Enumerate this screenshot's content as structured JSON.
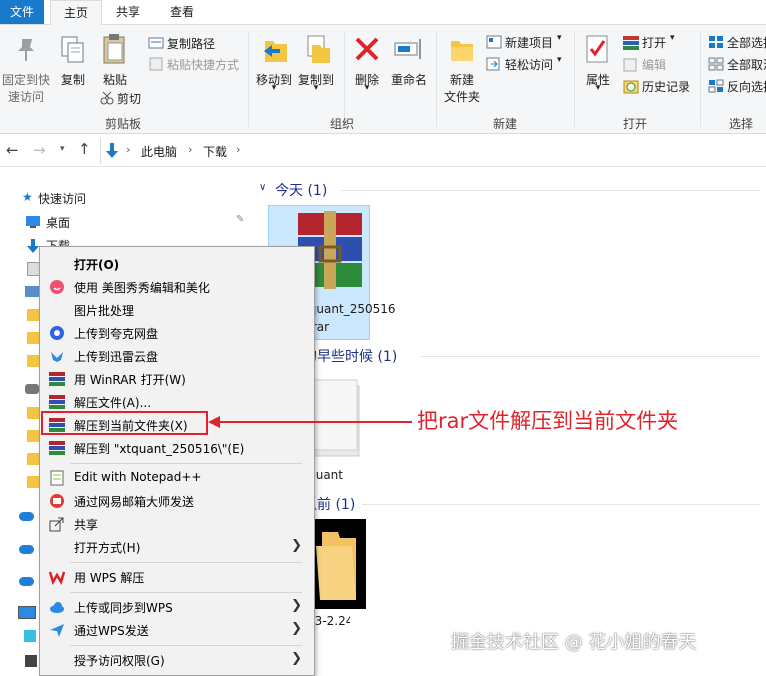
{
  "ribbon_tabs": [
    "文件",
    "主页",
    "共享",
    "查看"
  ],
  "ribbon": {
    "clipboard": {
      "pin": "固定到快",
      "pin2": "速访问",
      "copy": "复制",
      "paste": "粘贴",
      "copy_path": "复制路径",
      "paste_shortcut": "粘贴快捷方式",
      "cut": "剪切",
      "label": "剪贴板"
    },
    "organize": {
      "move_to": "移动到",
      "copy_to": "复制到",
      "delete": "删除",
      "rename": "重命名",
      "label": "组织"
    },
    "new": {
      "new_folder": "新建",
      "new_folder2": "文件夹",
      "new_item": "新建项目",
      "easy_access": "轻松访问",
      "label": "新建"
    },
    "open": {
      "properties": "属性",
      "open": "打开",
      "edit": "编辑",
      "history": "历史记录",
      "label": "打开"
    },
    "select": {
      "select_all": "全部选择",
      "select_none": "全部取消",
      "invert": "反向选择",
      "label": "选择"
    }
  },
  "breadcrumb": [
    "此电脑",
    "下载"
  ],
  "nav": {
    "quick_access": "快速访问",
    "desktop": "桌面",
    "downloads": "下载"
  },
  "content": {
    "today": "今天 (1)",
    "earlier_month": "本月的早些时候 (1)",
    "long_ago": "很久以前 (1)",
    "file1_line1": "xtquant_250516",
    "file1_line2": ".rar",
    "file2": "xtquant",
    "file3": "Anaconda3-2.24"
  },
  "context_menu": {
    "open": "打开(O)",
    "meitu": "使用 美图秀秀编辑和美化",
    "batch": "图片批处理",
    "kuake": "上传到夸克网盘",
    "xunlei": "上传到迅雷云盘",
    "winrar_open": "用 WinRAR 打开(W)",
    "extract": "解压文件(A)...",
    "extract_here": "解压到当前文件夹(X)",
    "extract_to": "解压到 \"xtquant_250516\\\"(E)",
    "notepad": "Edit with Notepad++",
    "netease": "通过网易邮箱大师发送",
    "share": "共享",
    "open_with": "打开方式(H)",
    "wps_extract": "用 WPS 解压",
    "wps_upload": "上传或同步到WPS",
    "wps_send": "通过WPS发送",
    "grant_access": "授予访问权限(G)"
  },
  "annotation": "把rar文件解压到当前文件夹",
  "watermark": "掘金技术社区 @ 花小姐的春天",
  "colors": {
    "accent": "#1979ca",
    "annotation_red": "#e0232a",
    "selection": "#cce8ff"
  }
}
